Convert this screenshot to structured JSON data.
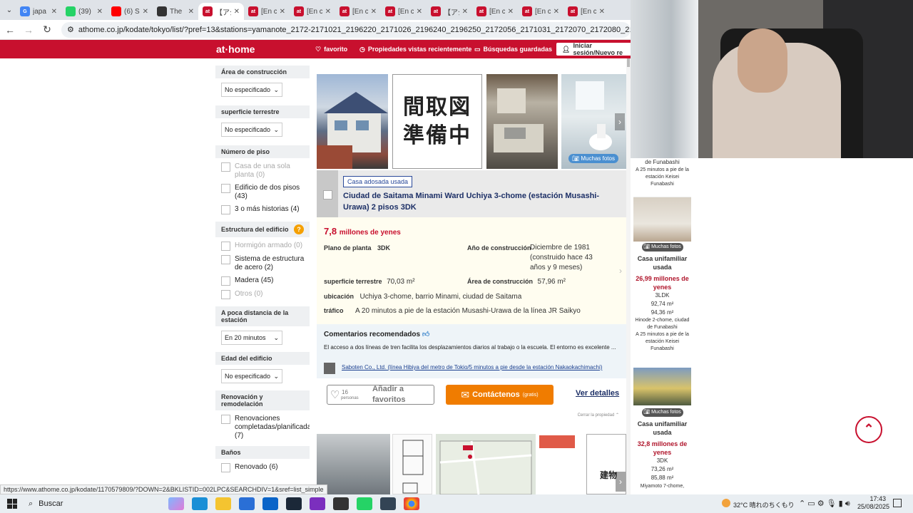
{
  "browser": {
    "tabs": [
      {
        "title": "japa",
        "color": "#4285f4",
        "letter": "G"
      },
      {
        "title": "(39)",
        "color": "#25d366",
        "letter": ""
      },
      {
        "title": "(6) S",
        "color": "#ff0000",
        "letter": ""
      },
      {
        "title": "The",
        "color": "#333333",
        "letter": ""
      },
      {
        "title": "【アジ",
        "color": "#c8102e",
        "letter": "at"
      },
      {
        "title": "[En c",
        "color": "#c8102e",
        "letter": "at"
      },
      {
        "title": "[En c",
        "color": "#c8102e",
        "letter": "at"
      },
      {
        "title": "[En c",
        "color": "#c8102e",
        "letter": "at"
      },
      {
        "title": "[En c",
        "color": "#c8102e",
        "letter": "at"
      },
      {
        "title": "【アジ",
        "color": "#c8102e",
        "letter": "at"
      },
      {
        "title": "[En c",
        "color": "#c8102e",
        "letter": "at"
      },
      {
        "title": "[En c",
        "color": "#c8102e",
        "letter": "at"
      },
      {
        "title": "[En c",
        "color": "#c8102e",
        "letter": "at"
      }
    ],
    "url": "athome.co.jp/kodate/tokyo/list/?pref=13&stations=yamanote_2172-2171021_2196220_2171026_2196240_2196250_2172056_2171031_2172070_2172080_2172090_2172100_2172110_2172120"
  },
  "site": {
    "logo": "at·home",
    "favorito": "favorito",
    "vistas": "Propiedades vistas recientemente",
    "busquedas": "Búsquedas guardadas",
    "login": "Iniciar sesión/Nuevo re"
  },
  "sidebar": {
    "area_construccion": "Área de construcción",
    "no_esp1": "No especificado",
    "superficie": "superficie terrestre",
    "no_esp2": "No especificado",
    "numero_piso": "Número de piso",
    "pisos": [
      {
        "label": "Casa de una sola planta",
        "count": "(0)",
        "dis": true
      },
      {
        "label": "Edificio de dos pisos",
        "count": "(43)",
        "dis": false
      },
      {
        "label": "3 o más historias",
        "count": "(4)",
        "dis": false
      }
    ],
    "estructura": "Estructura del edificio",
    "estructuras": [
      {
        "label": "Hormigón armado",
        "count": "(0)",
        "dis": true
      },
      {
        "label": "Sistema de estructura de acero",
        "count": "(2)",
        "dis": false
      },
      {
        "label": "Madera",
        "count": "(45)",
        "dis": false
      },
      {
        "label": "Otros",
        "count": "(0)",
        "dis": true
      }
    ],
    "distancia": "A poca distancia de la estación",
    "en20": "En 20 minutos",
    "edad": "Edad del edificio",
    "no_esp3": "No especificado",
    "renovacion": "Renovación y remodelación",
    "renov": {
      "label": "Renovaciones completadas/planificadas",
      "count": "(7)"
    },
    "banos": "Baños",
    "renovado": {
      "label": "Renovado",
      "count": "(6)"
    }
  },
  "listing": {
    "floorplan_text": "間取図準備中",
    "muchas_fotos": "Muchas fotos",
    "badge": "Casa adosada usada",
    "title": "Ciudad de Saitama Minami Ward Uchiya 3-chome (estación Musashi-Urawa) 2 pisos 3DK",
    "price_num": "7,8",
    "price_unit": "millones de yenes",
    "plano_label": "Plano de planta",
    "plano": "3DK",
    "ano_label": "Año de construcción",
    "ano": "Diciembre de 1981 (construido hace 43 años y 9 meses)",
    "sup_label": "superficie terrestre",
    "sup": "70,03 m²",
    "area_label": "Área de construcción",
    "area": "57,96 m²",
    "ubic_label": "ubicación",
    "ubic": "Uchiya 3-chome, barrio Minami, ciudad de Saitama",
    "traf_label": "tráfico",
    "traf": "A 20 minutos a pie de la estación Musashi-Urawa de la línea JR Saikyo",
    "com_title": "Comentarios recomendados",
    "com_text": "El acceso a dos líneas de tren facilita los desplazamientos diarios al trabajo o la escuela. El entorno es excelente ...",
    "agency": "Saboten Co., Ltd. (línea Hibiya del metro de Tokio/5 minutos a pie desde la estación Nakaokachimachi)",
    "fav_count": "16",
    "fav_people": "personas",
    "fav_label": "Añadir a favoritos",
    "contact": "Contáctenos",
    "gratis": "(gratis)",
    "ver": "Ver detalles",
    "cerrar": "Cerrar la propiedad",
    "new_tag": "建物"
  },
  "right": {
    "card0": {
      "top": "de Funabashi",
      "walk": "A 25 minutos a pie de la estación Keisei Funabashi"
    },
    "card1": {
      "fotos": "Muchas fotos",
      "type": "Casa unifamiliar usada",
      "price": "26,99 millones de yenes",
      "plan": "3LDK",
      "m1": "92,74 m²",
      "m2": "94,36 m²",
      "loc": "Hinode 2-chome, ciudad de Funabashi",
      "walk": "A 25 minutos a pie de la estación Keisei Funabashi"
    },
    "card2": {
      "fotos": "Muchas fotos",
      "type": "Casa unifamiliar usada",
      "price": "32,8 millones de yenes",
      "plan": "3DK",
      "m1": "73,26 m²",
      "m2": "85,88 m²",
      "loc": "Miyamoto 7-chome,"
    }
  },
  "status_url": "https://www.athome.co.jp/kodate/1170579809/?DOWN=2&BKLISTID=002LPC&SEARCHDIV=1&sref=list_simple",
  "taskbar": {
    "search": "Buscar",
    "temp": "32°C",
    "weather": "晴れのちくもり",
    "time": "17:43",
    "date": "25/08/2025"
  },
  "colors": {
    "brand": "#c8102e",
    "orange": "#f07c00",
    "navy": "#1c2f66"
  }
}
